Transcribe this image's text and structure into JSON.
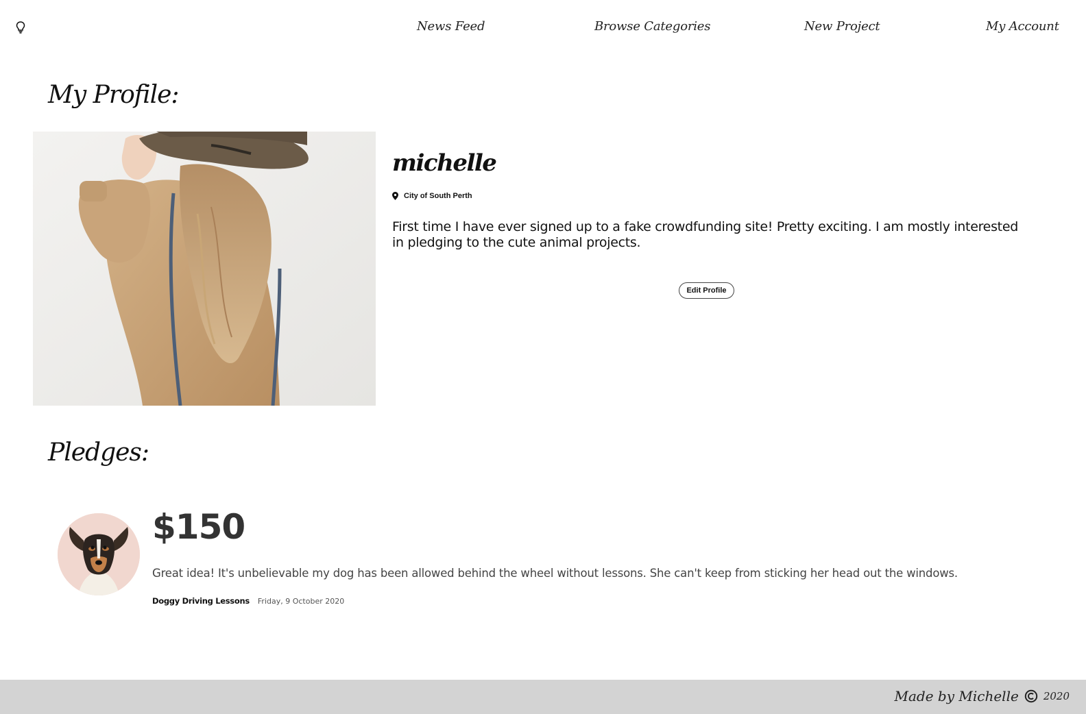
{
  "nav": {
    "logo_icon": "lightbulb-icon",
    "links": [
      {
        "label": "News Feed"
      },
      {
        "label": "Browse Categories"
      },
      {
        "label": "New Project"
      },
      {
        "label": "My Account"
      }
    ]
  },
  "profile": {
    "section_title": "My Profile:",
    "username": "michelle",
    "location_icon": "map-pin-icon",
    "location": "City of South Perth",
    "bio": "First time I have ever signed up to a fake crowdfunding site! Pretty exciting. I am mostly interested in pledging to the cute animal projects.",
    "edit_button_label": "Edit Profile"
  },
  "pledges": {
    "section_title": "Pledges:",
    "items": [
      {
        "amount": "$150",
        "comment": "Great idea! It's unbelievable my dog has been allowed behind the wheel without lessons. She can't keep from sticking her head out the windows.",
        "project": "Doggy Driving Lessons",
        "date": "Friday, 9 October 2020"
      }
    ]
  },
  "footer": {
    "text": "Made by Michelle",
    "copyright_icon": "copyright-icon",
    "year": "2020",
    "background": "#d3d3d3"
  }
}
